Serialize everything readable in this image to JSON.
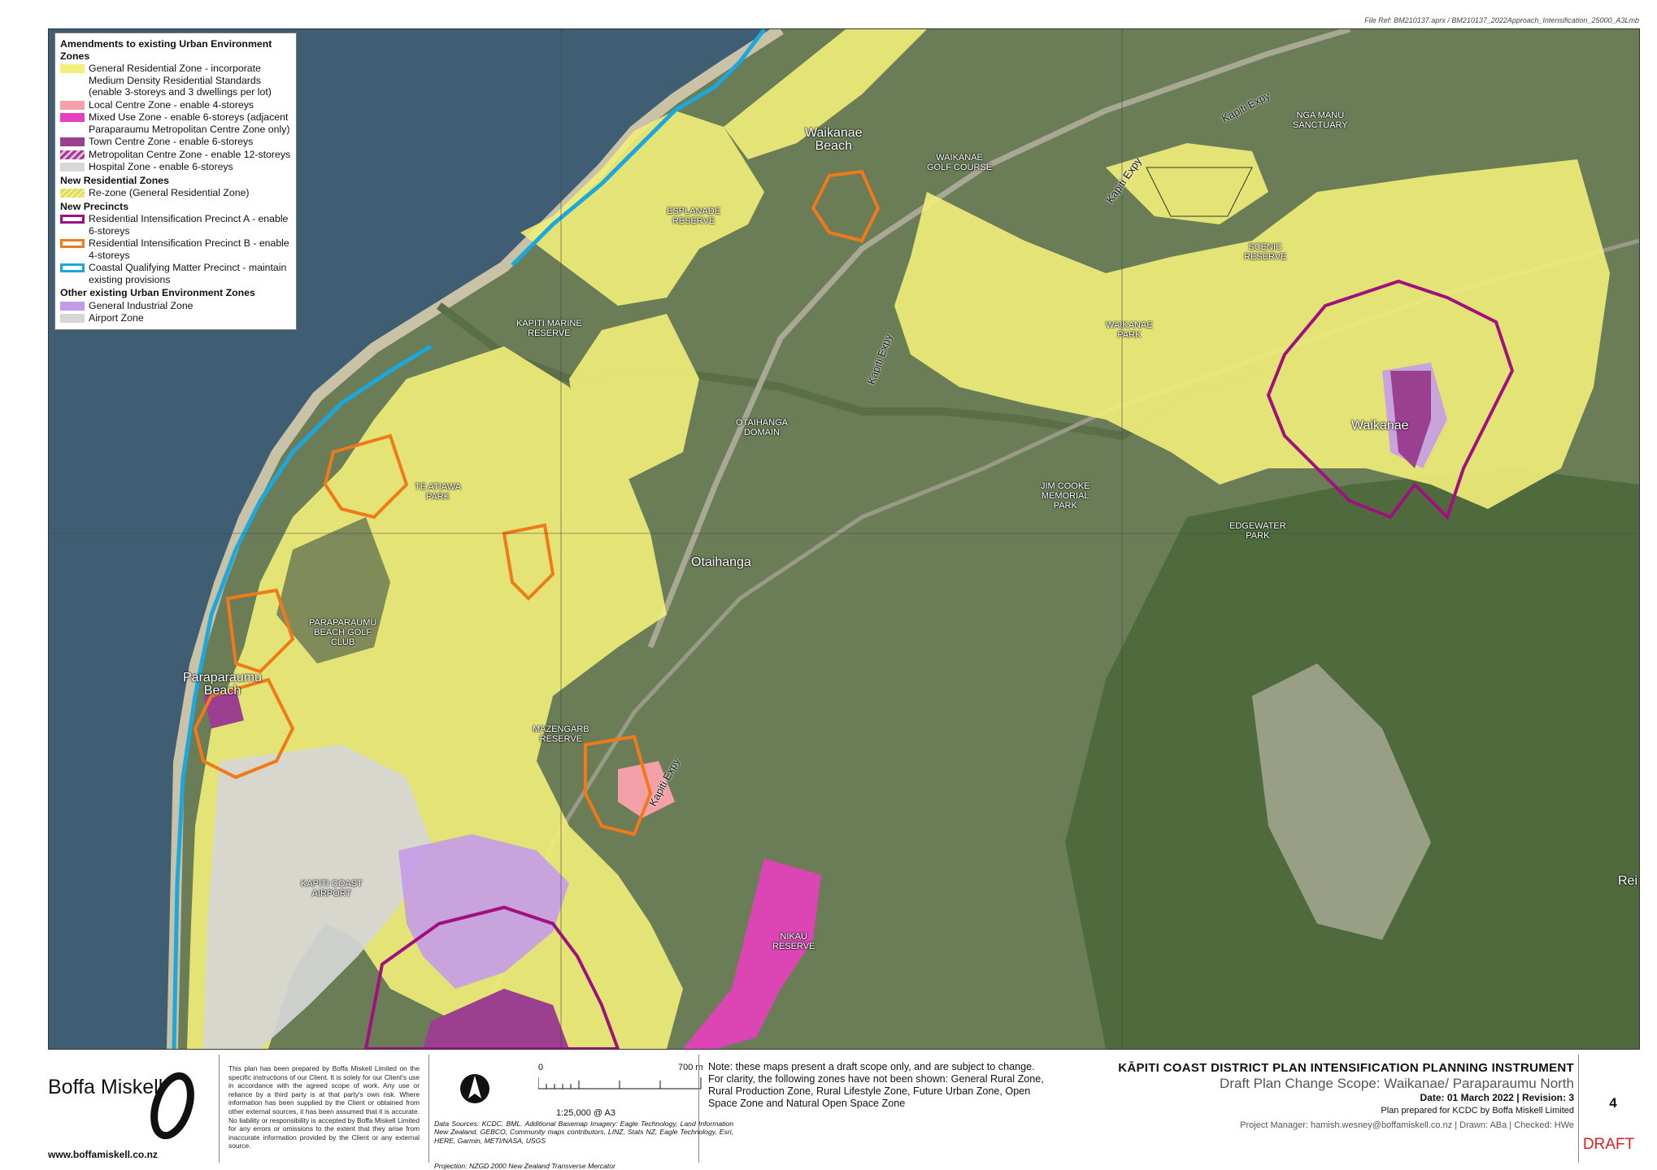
{
  "file_ref": "File Ref: BM210137.aprx / BM210137_2022Approach_Intensification_25000_A3Lmb",
  "legend": {
    "heading1": "Amendments to existing Urban Environment Zones",
    "items1": [
      {
        "label": "General Residential Zone - incorporate Medium Density Residential Standards (enable 3-storeys and 3 dwellings per lot)",
        "color": "#f2ef7a"
      },
      {
        "label": "Local Centre Zone - enable 4-storeys",
        "color": "#f4a0a8"
      },
      {
        "label": "Mixed Use Zone - enable 6-storeys (adjacent Paraparaumu Metropolitan Centre Zone only)",
        "color": "#e83fbf"
      },
      {
        "label": "Town Centre Zone - enable 6-storeys",
        "color": "#9b3f91"
      },
      {
        "label": "Metropolitan Centre Zone - enable 12-storeys",
        "color": "#9b3f91"
      },
      {
        "label": "Hospital Zone - enable 6-storeys",
        "color": "#d8d8d8"
      }
    ],
    "heading2": "New Residential Zones",
    "items2": [
      {
        "label": "Re-zone (General Residential Zone)",
        "color": "#f2ef7a"
      }
    ],
    "heading3": "New Precincts",
    "items3": [
      {
        "label": "Residential Intensification Precinct A - enable 6-storeys",
        "color": "#a0107e"
      },
      {
        "label": "Residential Intensification Precinct B - enable 4-storeys",
        "color": "#f07a1a"
      },
      {
        "label": "Coastal Qualifying Matter Precinct - maintain existing provisions",
        "color": "#1aa8de"
      }
    ],
    "heading4": "Other existing Urban Environment Zones",
    "items4": [
      {
        "label": "General Industrial Zone",
        "color": "#c49be8"
      },
      {
        "label": "Airport Zone",
        "color": "#d6d6d6"
      }
    ]
  },
  "map_labels": {
    "waikanae_beach": "Waikanae\nBeach",
    "esplanade": "ESPLANADE\nRESERVE",
    "waikanae_golf": "WAIKANAE\nGOLF COURSE",
    "kapiti_expy_1": "Kapiti Expy",
    "kapiti_expy_2": "Kapiti Expy",
    "kapiti_expy_3": "Kapiti Expy",
    "kapiti_expy_4": "Kapiti Expy",
    "nga_manu": "NGA MANU\nSANCTUARY",
    "scenic": "SCENIC\nRESERVE",
    "kapiti_marine": "KAPITI MARINE\nRESERVE",
    "waikanae_park": "WAIKANAE\nPARK",
    "otaihanga_domain": "OTAIHANGA\nDOMAIN",
    "waikanae": "Waikanae",
    "te_atiawa": "TE ATIAWA\nPARK",
    "jim_cooke": "JIM COOKE\nMEMORIAL\nPARK",
    "edgewater": "EDGEWATER\nPARK",
    "otaihanga": "Otaihanga",
    "paraparaumu_golf": "PARAPARAUMU\nBEACH GOLF\nCLUB",
    "paraparaumu_beach": "Paraparaumu\nBeach",
    "mazengarb": "MAZENGARB\nRESERVE",
    "kapiti_airport": "KAPITI COAST\nAIRPORT",
    "nikau": "NIKAU\nRESERVE",
    "rei": "Rei"
  },
  "footer": {
    "logo_name": "Boffa Miskell",
    "logo_url": "www.boffamiskell.co.nz",
    "disclaimer": "This plan has been prepared by Boffa Miskell Limited on the specific instructions of our Client. It is solely for our Client's use in accordance with the agreed scope of work. Any use or reliance by a third party is at that party's own risk. Where information has been supplied by the Client or obtained from other external sources, it has been assumed that it is accurate. No liability or responsibility is accepted by Boffa Miskell Limited for any errors or omissions to the extent that they arise from inaccurate information provided by the Client or any external source.",
    "scale_zero": "0",
    "scale_end": "700 m",
    "scale_ratio": "1:25,000 @ A3",
    "sources": "Data Sources: KCDC, BML. Additional Basemap Imagery: Eagle Technology, Land Information New Zealand, GEBCO, Community maps contributors, LINZ, Stats NZ, Eagle Technology, Esri, HERE, Garmin, METI/NASA, USGS",
    "projection": "Projection: NZGD 2000 New Zealand Transverse Mercator",
    "note": "Note: these maps present a draft scope only, and are subject to change. For clarity, the following zones have not been shown: General Rural Zone, Rural Production Zone, Rural Lifestyle Zone, Future Urban Zone, Open Space Zone and Natural Open Space Zone",
    "title": "KĀPITI COAST DISTRICT PLAN INTENSIFICATION PLANNING INSTRUMENT",
    "subtitle": "Draft Plan Change Scope: Waikanae/ Paraparaumu North",
    "date_rev": "Date: 01 March 2022  |  Revision: 3",
    "prepared": "Plan prepared for KCDC by Boffa Miskell Limited",
    "pm": "Project Manager: hamish.wesney@boffamiskell.co.nz  |  Drawn: ABa  |  Checked: HWe",
    "page": "4",
    "draft": "DRAFT"
  }
}
